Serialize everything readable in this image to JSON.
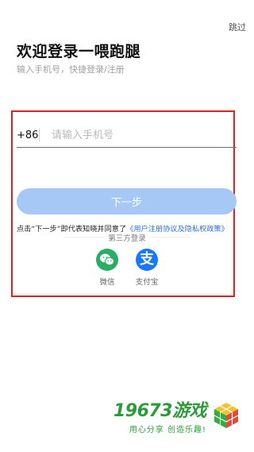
{
  "header": {
    "skip_label": "跳过",
    "title": "欢迎登录一喂跑腿",
    "subtitle": "输入手机号，快捷登录/注册"
  },
  "form": {
    "country_code": "+86",
    "phone_placeholder": "请输入手机号",
    "phone_value": "",
    "next_label": "下一步"
  },
  "agreement": {
    "prefix": "点击“下一步”即代表知晓并同意了",
    "link": "《用户注册协议及隐私权政策》"
  },
  "third_party": {
    "title": "第三方登录",
    "items": [
      {
        "label": "微信",
        "icon": "wechat-icon",
        "color": "#2aae67"
      },
      {
        "label": "支付宝",
        "icon": "alipay-icon",
        "color": "#1677ff",
        "glyph": "支"
      }
    ]
  },
  "watermark": {
    "brand": "19673游戏",
    "slogan": "用心分享 创造乐趣!"
  },
  "colors": {
    "accent": "#a6c8f5",
    "link": "#2f6fd8",
    "highlight_border": "#e02020"
  }
}
